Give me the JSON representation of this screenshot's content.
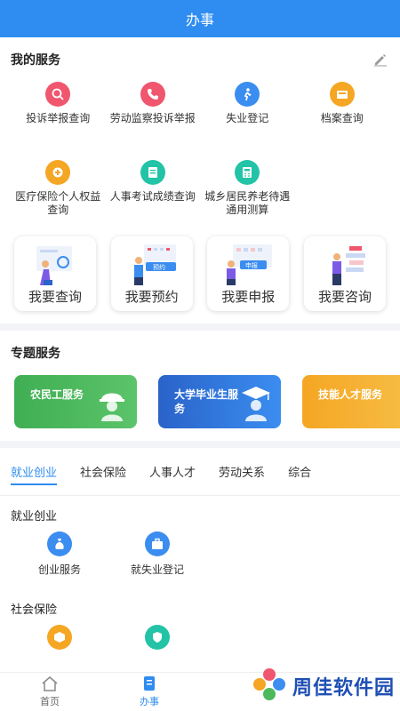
{
  "header": {
    "title": "办事"
  },
  "my_services": {
    "title": "我的服务",
    "items": [
      {
        "label": "投诉举报查询",
        "icon": "search-complaint-icon",
        "color": "#f0566e"
      },
      {
        "label": "劳动监察投诉举报",
        "icon": "phone-icon",
        "color": "#f0566e"
      },
      {
        "label": "失业登记",
        "icon": "runner-icon",
        "color": "#3b8df0"
      },
      {
        "label": "档案查询",
        "icon": "archive-icon",
        "color": "#f5a623"
      },
      {
        "label": "医疗保险个人权益查询",
        "icon": "medical-icon",
        "color": "#f5a623"
      },
      {
        "label": "人事考试成绩查询",
        "icon": "exam-icon",
        "color": "#22c3a6"
      },
      {
        "label": "城乡居民养老待遇通用测算",
        "icon": "calculator-icon",
        "color": "#22c3a6"
      }
    ]
  },
  "quick_cards": [
    {
      "label": "我要查询",
      "badge": ""
    },
    {
      "label": "我要预约",
      "badge": "预约"
    },
    {
      "label": "我要申报",
      "badge": "申报"
    },
    {
      "label": "我要咨询",
      "badge": ""
    }
  ],
  "topics": {
    "title": "专题服务",
    "items": [
      {
        "label": "农民工服务",
        "color": "#4cb85c"
      },
      {
        "label": "大学毕业生服务",
        "color": "#2a63c9"
      },
      {
        "label": "技能人才服务",
        "color": "#f5a623"
      }
    ]
  },
  "tabs": [
    {
      "label": "就业创业",
      "active": true
    },
    {
      "label": "社会保险",
      "active": false
    },
    {
      "label": "人事人才",
      "active": false
    },
    {
      "label": "劳动关系",
      "active": false
    },
    {
      "label": "综合",
      "active": false
    }
  ],
  "employment": {
    "title": "就业创业",
    "items": [
      {
        "label": "创业服务",
        "icon": "bag-icon",
        "color": "#3b8df0"
      },
      {
        "label": "就失业登记",
        "icon": "briefcase-icon",
        "color": "#3b8df0"
      }
    ]
  },
  "social_insurance": {
    "title": "社会保险",
    "items": [
      {
        "label": "",
        "icon": "box-icon",
        "color": "#f5a623"
      },
      {
        "label": "",
        "icon": "shield-icon",
        "color": "#22c3a6"
      }
    ]
  },
  "bottom_nav": [
    {
      "label": "首页",
      "icon": "home-icon",
      "active": false
    },
    {
      "label": "办事",
      "icon": "document-icon",
      "active": true
    }
  ],
  "watermark": {
    "text": "周佳软件园"
  }
}
